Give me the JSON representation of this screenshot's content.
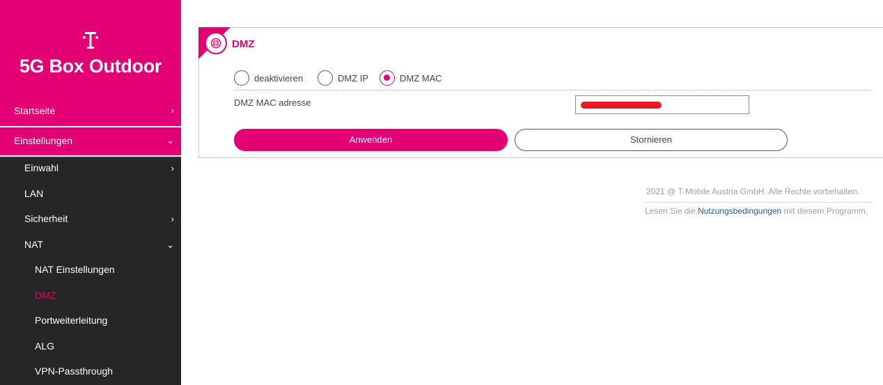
{
  "brand": {
    "title": "5G Box Outdoor",
    "logo": "telekom-t-logo",
    "color": "#e20074"
  },
  "sidebar": {
    "top_items": [
      {
        "label": "Startseite",
        "chevron": "›"
      },
      {
        "label": "Einstellungen",
        "chevron": "⌄"
      }
    ],
    "items": [
      {
        "label": "Einwahl",
        "chevron": "›"
      },
      {
        "label": "LAN"
      },
      {
        "label": "Sicherheit",
        "chevron": "›"
      },
      {
        "label": "NAT",
        "chevron": "⌄"
      },
      {
        "label": "NAT Einstellungen"
      },
      {
        "label": "DMZ"
      },
      {
        "label": "Portweiterleitung"
      },
      {
        "label": "ALG"
      },
      {
        "label": "VPN-Passthrough"
      }
    ]
  },
  "panel": {
    "title": "DMZ",
    "icon": "dmz-shield-icon",
    "radios": [
      {
        "label": "deaktivieren",
        "checked": false
      },
      {
        "label": "DMZ IP",
        "checked": false
      },
      {
        "label": "DMZ MAC",
        "checked": true
      }
    ],
    "mac_label": "DMZ MAC adresse",
    "apply_label": "Anwenden",
    "cancel_label": "Stornieren"
  },
  "footer": {
    "copyright": "2021 @ T-Mobile Austria GmbH. Alle Rechte vorbehalten.",
    "terms_prefix": "Lesen Sie die ",
    "terms_link": "Nutzungsbedingungen",
    "terms_suffix": " mit diesem Programm."
  }
}
